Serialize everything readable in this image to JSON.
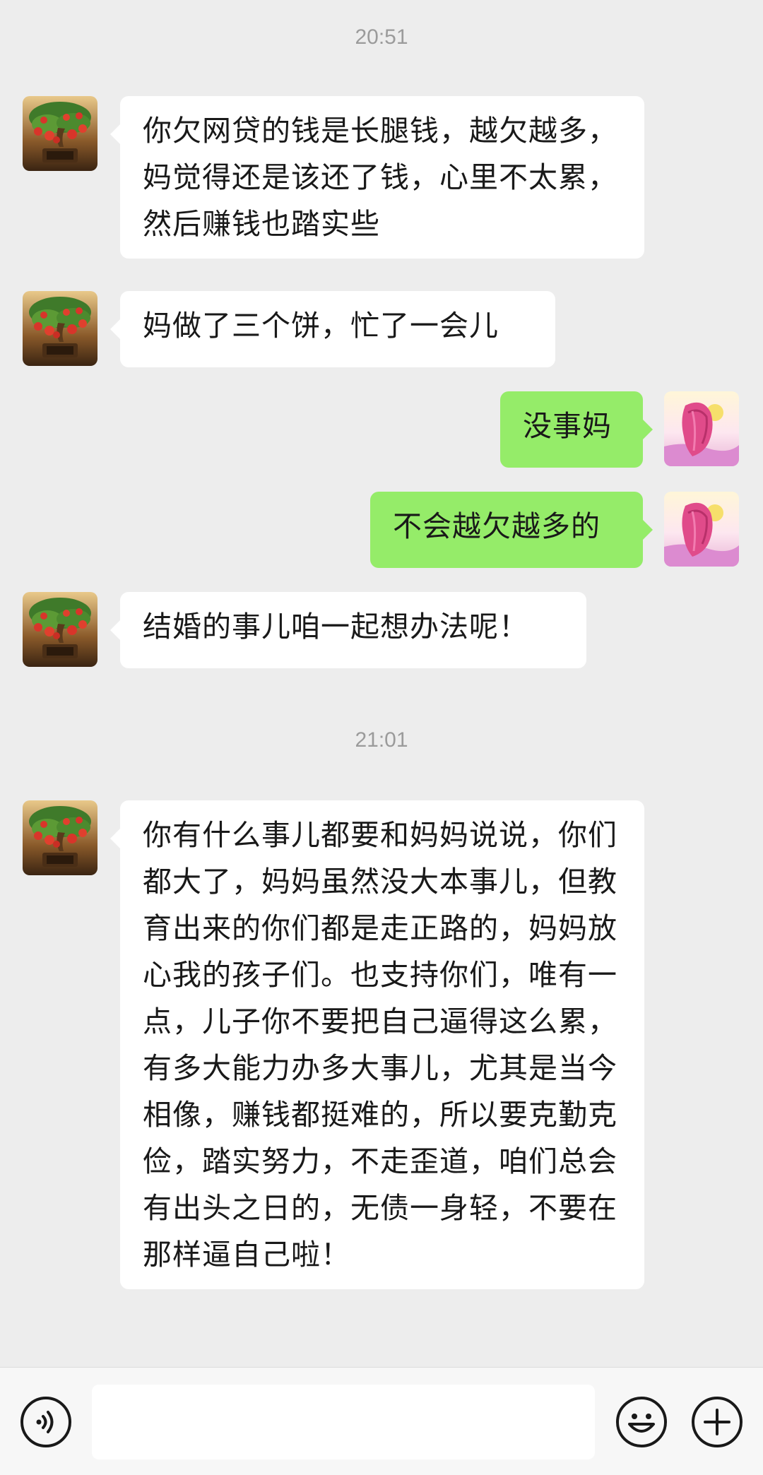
{
  "chat": {
    "timestamps": [
      "20:51",
      "21:01"
    ],
    "messages": [
      {
        "from": "mom",
        "text": "你欠网贷的钱是长腿钱，越欠越多，妈觉得还是该还了钱，心里不太累，然后赚钱也踏实些"
      },
      {
        "from": "mom",
        "text": "妈做了三个饼，忙了一会儿"
      },
      {
        "from": "me",
        "text": "没事妈"
      },
      {
        "from": "me",
        "text": "不会越欠越多的"
      },
      {
        "from": "mom",
        "text": "结婚的事儿咱一起想办法呢！"
      },
      {
        "from": "mom",
        "text": "你有什么事儿都要和妈妈说说，你们都大了，妈妈虽然没大本事儿，但教育出来的你们都是走正路的，妈妈放心我的孩子们。也支持你们，唯有一点，儿子你不要把自己逼得这么累，有多大能力办多大事儿，尤其是当今相像，赚钱都挺难的，所以要克勤克俭，踏实努力，不走歪道，咱们总会有出头之日的，无债一身轻，不要在那样逼自己啦！"
      }
    ],
    "avatars": {
      "mom": {
        "icon": "bonsai-fruit-tree-icon",
        "plaque_text": "五福临门"
      },
      "me": {
        "icon": "pink-hair-girl-icon"
      }
    }
  },
  "input_bar": {
    "voice_icon": "voice-icon",
    "emoji_icon": "emoji-icon",
    "plus_icon": "plus-icon",
    "value": ""
  },
  "colors": {
    "background": "#ededed",
    "incoming_bubble": "#ffffff",
    "outgoing_bubble": "#95ec69",
    "timestamp": "#9b9b9b"
  }
}
